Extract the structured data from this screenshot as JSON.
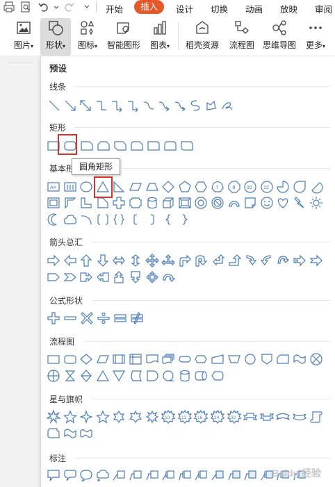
{
  "toolbar": {
    "tabs": [
      "开始",
      "插入",
      "设计",
      "切换",
      "动画",
      "放映",
      "审阅"
    ],
    "active_tab": "插入",
    "ribbon": [
      {
        "label": "图片",
        "icon": "picture-icon",
        "dropdown": true
      },
      {
        "label": "形状",
        "icon": "shapes-icon",
        "dropdown": true,
        "selected": true
      },
      {
        "label": "图标",
        "icon": "icons-icon",
        "dropdown": true
      },
      {
        "label": "智能图形",
        "icon": "smartart-icon",
        "dropdown": false
      },
      {
        "label": "图表",
        "icon": "chart-icon",
        "dropdown": true
      },
      {
        "label": "稻壳资源",
        "icon": "docer-resource-icon",
        "dropdown": false
      },
      {
        "label": "流程图",
        "icon": "flowchart-icon",
        "dropdown": false
      },
      {
        "label": "思维导图",
        "icon": "mindmap-icon",
        "dropdown": false
      },
      {
        "label": "更多",
        "icon": "more-icon",
        "dropdown": true
      }
    ]
  },
  "panel": {
    "title": "预设",
    "sections": [
      {
        "name": "线条"
      },
      {
        "name": "矩形"
      },
      {
        "name": "基本形状"
      },
      {
        "name": "箭头总汇"
      },
      {
        "name": "公式形状"
      },
      {
        "name": "流程图"
      },
      {
        "name": "星与旗帜"
      },
      {
        "name": "标注"
      }
    ],
    "tooltip": "圆角矩形"
  },
  "colors": {
    "accent": "#e8572a",
    "highlight": "#d9312a",
    "shape_stroke": "#4a7cb5"
  },
  "watermark": "Baidu 经验"
}
